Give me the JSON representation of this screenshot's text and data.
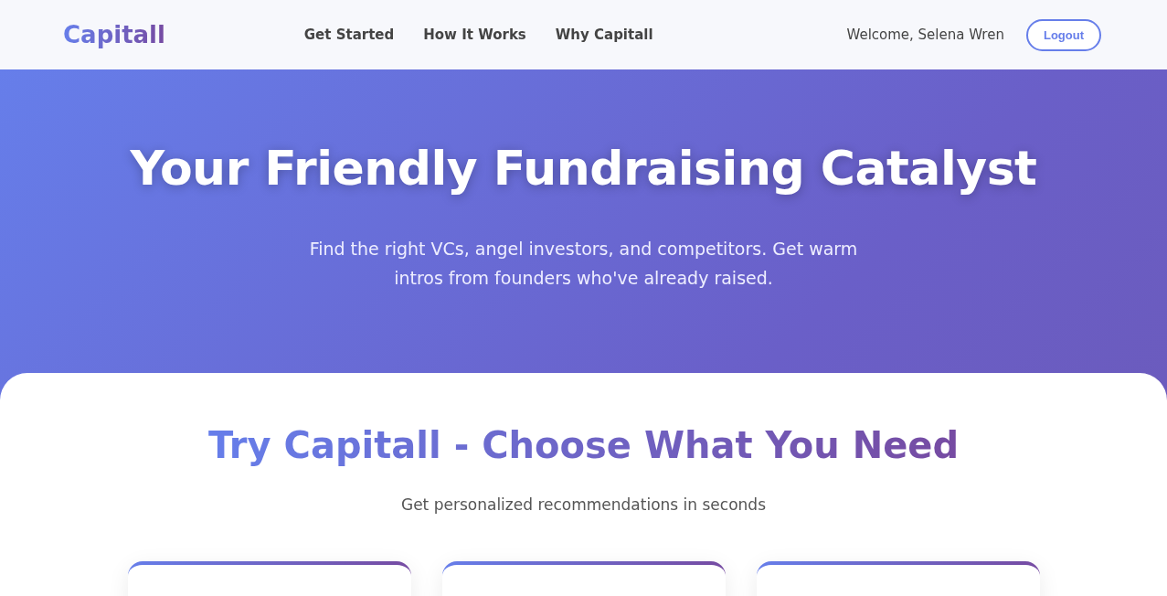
{
  "header": {
    "logo": "Capitall",
    "nav": [
      {
        "label": "Get Started"
      },
      {
        "label": "How It Works"
      },
      {
        "label": "Why Capitall"
      }
    ],
    "welcome": "Welcome, Selena Wren",
    "logout": "Logout"
  },
  "hero": {
    "title": "Your Friendly Fundraising Catalyst",
    "subtitle": "Find the right VCs, angel investors, and competitors. Get warm intros from founders who've already raised."
  },
  "section": {
    "title": "Try Capitall - Choose What You Need",
    "subtitle": "Get personalized recommendations in seconds",
    "cards": [
      {
        "kind": "option-card"
      },
      {
        "kind": "option-card"
      },
      {
        "kind": "option-card"
      }
    ]
  }
}
